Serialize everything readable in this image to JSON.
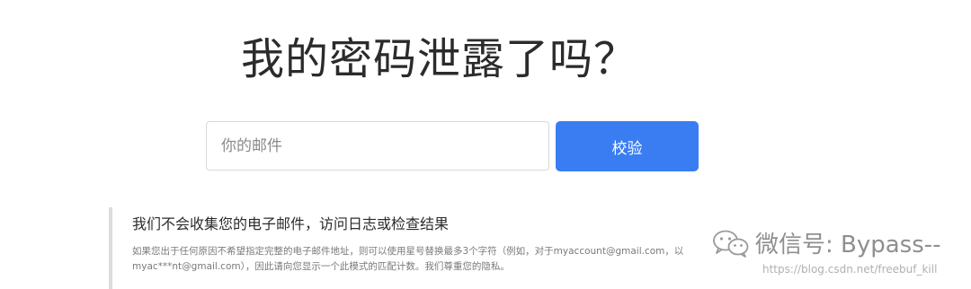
{
  "title": "我的密码泄露了吗？",
  "form": {
    "email_placeholder": "你的邮件",
    "email_value": "",
    "check_button_label": "校验"
  },
  "notice": {
    "heading": "我们不会收集您的电子邮件，访问日志或检查结果",
    "body": "如果您出于任何原因不希望指定完整的电子邮件地址，则可以使用星号替换最多3个字符（例如，对于myaccount@gmail.com，以myac***nt@gmail.com），因此请向您显示一个此模式的匹配计数。我们尊重您的隐私。"
  },
  "watermark": {
    "text": "微信号: Bypass--",
    "icon": "wechat-icon",
    "url": "https://blog.csdn.net/freebuf_kill"
  }
}
